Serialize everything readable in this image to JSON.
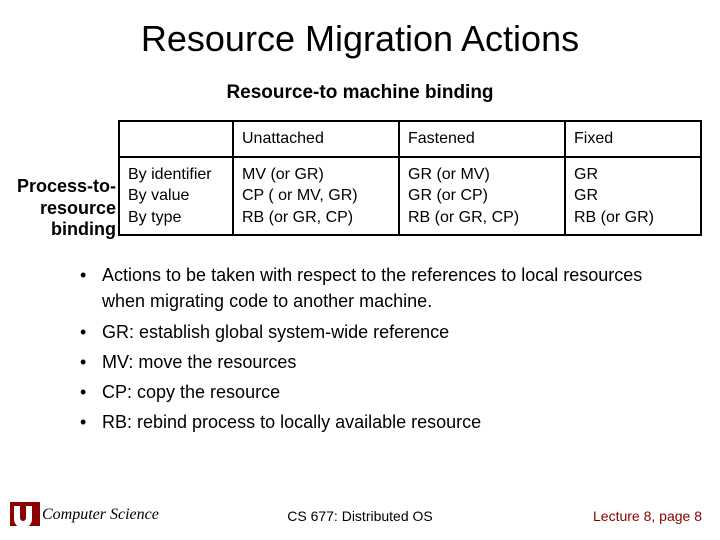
{
  "title": "Resource Migration Actions",
  "subtitle": "Resource-to machine binding",
  "side_label_html": "Process-to-<br>resource<br>binding",
  "table": {
    "headers": [
      "",
      "Unattached",
      "Fastened",
      "Fixed"
    ],
    "rows": [
      {
        "label_html": "By identifier<br>By value<br>By type",
        "c1_html": "MV (or GR)<br>CP ( or MV, GR)<br>RB (or GR, CP)",
        "c2_html": "GR (or MV)<br>GR (or CP)<br>RB (or GR, CP)",
        "c3_html": "GR<br>GR<br>RB (or GR)"
      }
    ]
  },
  "bullets": [
    "Actions to be taken with respect to the references to local resources when migrating code to another machine.",
    "GR: establish global  system-wide reference",
    "MV: move the resources",
    "CP: copy the resource",
    "RB: rebind process to locally available resource"
  ],
  "footer": {
    "dept": "Computer Science",
    "course": "CS 677: Distributed OS",
    "page": "Lecture 8, page 8"
  }
}
